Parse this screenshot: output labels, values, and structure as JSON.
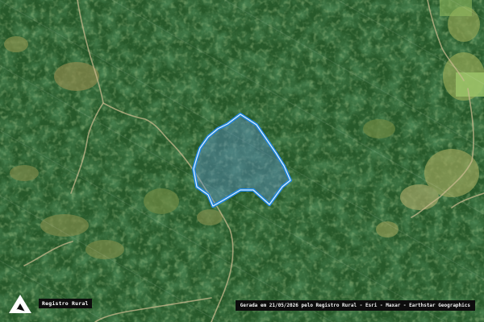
{
  "map": {
    "basemap": "satellite",
    "highlight_colors": {
      "outline": "#1e88e5",
      "inner_outline": "#e3f2fd",
      "fill": "#5b8fc4",
      "fill_opacity": 0.45
    }
  },
  "branding": {
    "logo_icon": "registro-rural-logo-icon",
    "brand_name": "Registro Rural"
  },
  "footer": {
    "attribution": "Gerada em 21/05/2026 pelo Registro Rural - Esri - Maxar - Earthstar Geographics"
  }
}
